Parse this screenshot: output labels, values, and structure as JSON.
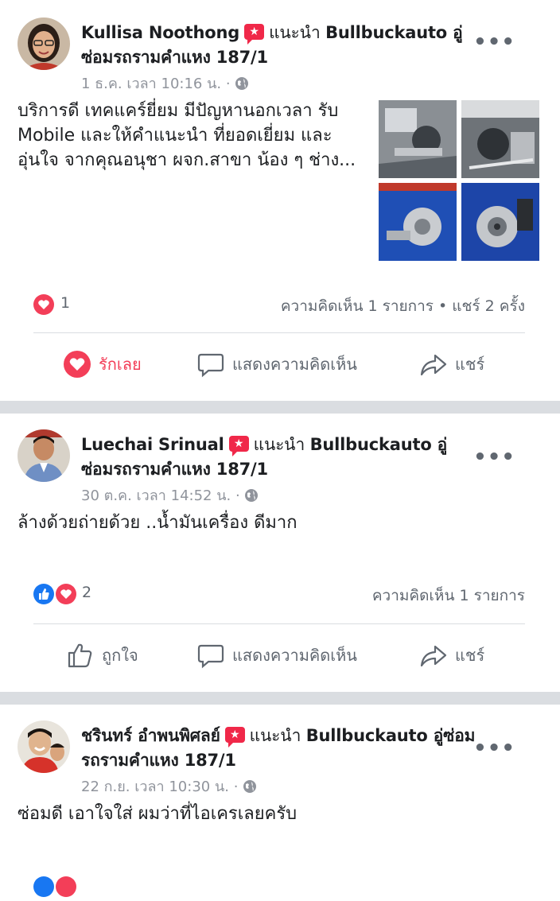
{
  "colors": {
    "love": "#f33e58",
    "like": "#1877f2",
    "separator": "#dadde1",
    "muted": "#90949c"
  },
  "posts": [
    {
      "author": "Kullisa Noothong",
      "action_prefix": "แนะนำ",
      "page": "Bullbuckauto อู่ซ่อมรถรามคำแหง 187/1",
      "time": "1 ธ.ค. เวลา 10:16 น.",
      "text_lines": [
        "บริการดี เทคแคร์ยี่ยม มีปัญหานอกเวลา รับ",
        "Mobile  และให้คำแนะนำ ที่ยอดเยี่ยม และ",
        "อุ่นใจ จากคุณอนุชา ผจก.สาขา น้อง ๆ ช่าง..."
      ],
      "reaction_count": "1",
      "stats_text": "ความคิดเห็น 1 รายการ • แชร์ 2 ครั้ง",
      "actions": {
        "react": "รักเลย",
        "comment": "แสดงความคิดเห็น",
        "share": "แชร์"
      },
      "photos": [
        "engine-photo-1",
        "engine-photo-2",
        "engine-photo-3",
        "engine-photo-4"
      ]
    },
    {
      "author": "Luechai Srinual",
      "action_prefix": "แนะนำ",
      "page": "Bullbuckauto อู่ซ่อมรถรามคำแหง 187/1",
      "time": "30 ต.ค. เวลา 14:52 น.",
      "text_lines": [
        "ล้างด้วยถ่ายด้วย ..น้ำมันเครื่อง ดีมาก"
      ],
      "reaction_count": "2",
      "stats_text": "ความคิดเห็น 1 รายการ",
      "actions": {
        "react": "ถูกใจ",
        "comment": "แสดงความคิดเห็น",
        "share": "แชร์"
      }
    },
    {
      "author": "ชรินทร์ อำพนพิศลย์",
      "action_prefix": "แนะนำ",
      "page": "Bullbuckauto อู่ซ่อมรถรามคำแหง 187/1",
      "time": "22 ก.ย. เวลา 10:30 น.",
      "text_lines": [
        "ซ่อมดี เอาใจใส่ ผมว่าที่ไอเครเลยครับ"
      ]
    }
  ]
}
